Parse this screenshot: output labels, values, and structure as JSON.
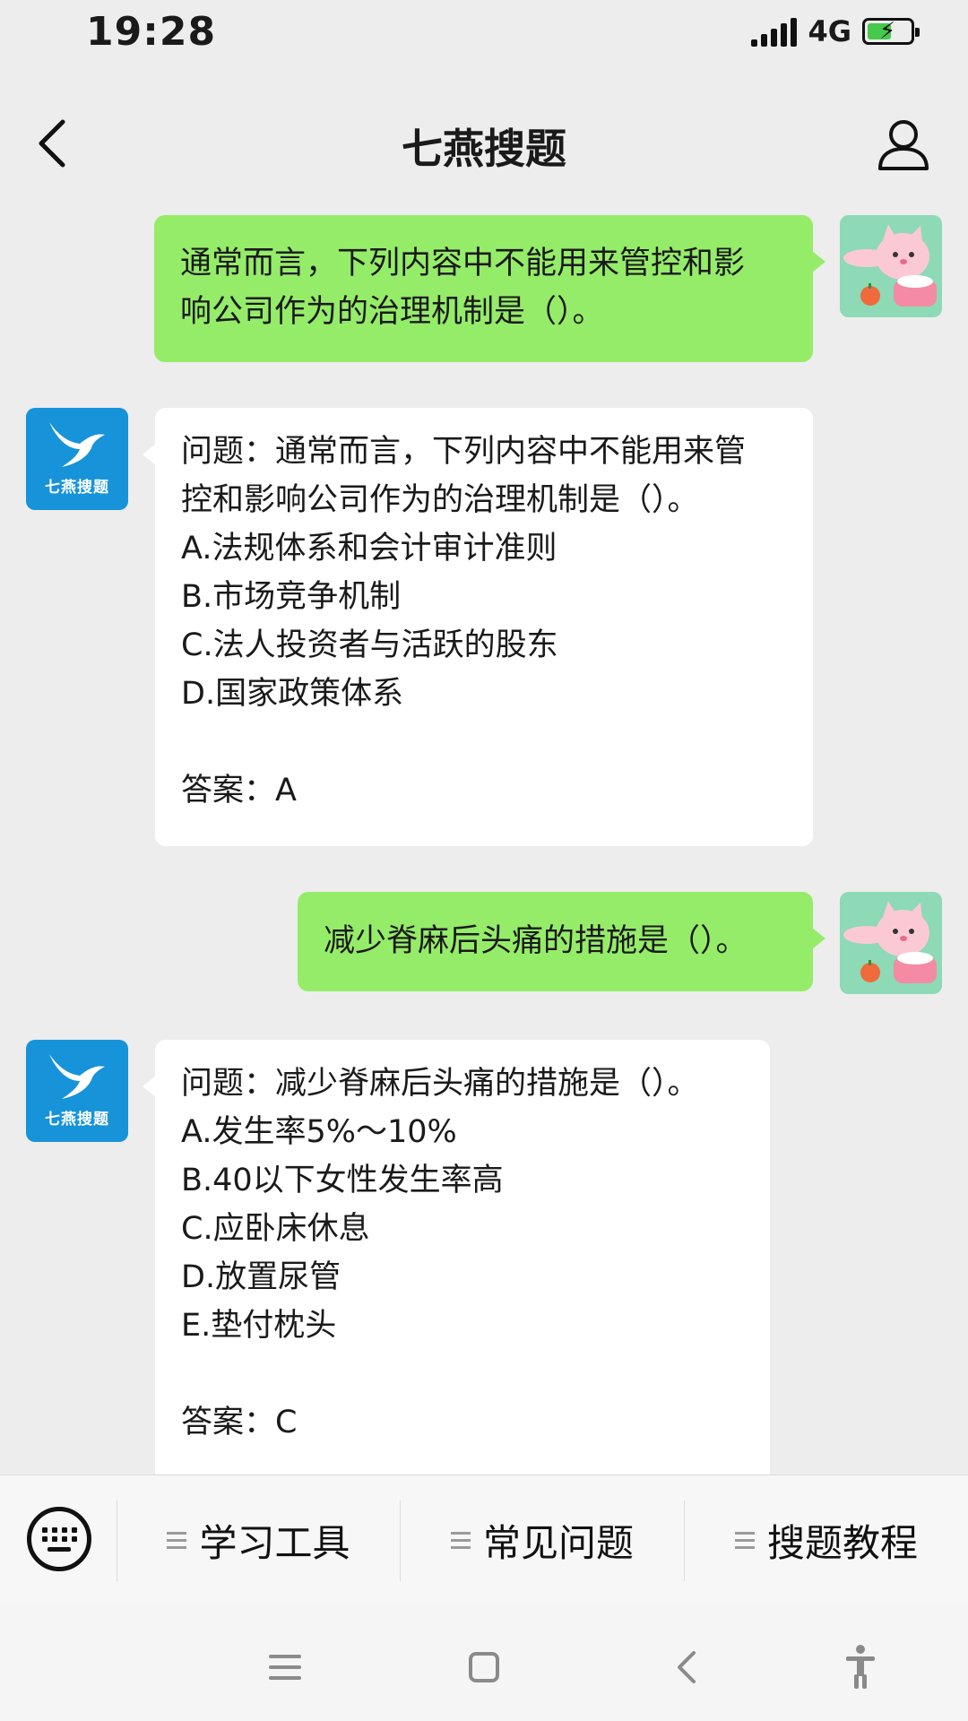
{
  "status": {
    "time": "19:28",
    "network": "4G"
  },
  "header": {
    "title": "七燕搜题"
  },
  "bot": {
    "avatar_text": "七燕搜题"
  },
  "messages": {
    "q1": [
      "通常而言，下列内容中不能用来管控和影",
      "响公司作为的治理机制是（）。"
    ],
    "a1": [
      "问题：通常而言，下列内容中不能用来管",
      "控和影响公司作为的治理机制是（）。",
      "A.法规体系和会计审计准则",
      "B.市场竞争机制",
      "C.法人投资者与活跃的股东",
      "D.国家政策体系",
      "答案：A"
    ],
    "q2": [
      "减少脊麻后头痛的措施是（）。"
    ],
    "a2": [
      "问题：减少脊麻后头痛的措施是（）。",
      "A.发生率5%～10%",
      "B.40以下女性发生率高",
      "C.应卧床休息",
      "D.放置尿管",
      "E.垫付枕头",
      "答案：C"
    ]
  },
  "menu": {
    "items": [
      "学习工具",
      "常见问题",
      "搜题教程"
    ]
  },
  "colors": {
    "user_bubble": "#95ec69",
    "bot_avatar": "#1793d9",
    "background": "#ededed"
  }
}
